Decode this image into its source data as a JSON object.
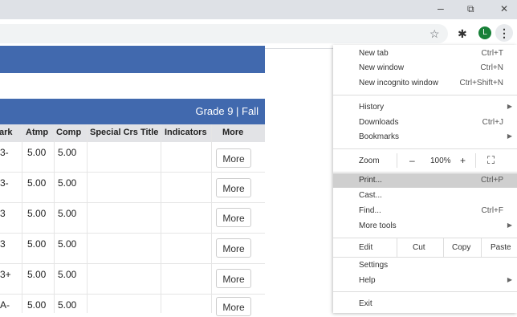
{
  "window": {
    "minimize_glyph": "–",
    "restore_glyph": "⧉",
    "close_glyph": "✕"
  },
  "toolbar": {
    "star_glyph": "☆",
    "extensions_glyph": "✱",
    "avatar_letter": "L",
    "menu_glyph": "⋮"
  },
  "table": {
    "grade_label": "Grade 9 | Fall",
    "columns": [
      "ark",
      "Atmp",
      "Comp",
      "Special Crs Title",
      "Indicators",
      "More"
    ],
    "rows": [
      {
        "mark": "3-",
        "atmp": "5.00",
        "comp": "5.00",
        "more": "More"
      },
      {
        "mark": "3-",
        "atmp": "5.00",
        "comp": "5.00",
        "more": "More"
      },
      {
        "mark": "3",
        "atmp": "5.00",
        "comp": "5.00",
        "more": "More"
      },
      {
        "mark": "3",
        "atmp": "5.00",
        "comp": "5.00",
        "more": "More"
      },
      {
        "mark": "3+",
        "atmp": "5.00",
        "comp": "5.00",
        "more": "More"
      },
      {
        "mark": "A-",
        "atmp": "5.00",
        "comp": "5.00",
        "more": "More"
      }
    ]
  },
  "menu": {
    "new_tab": "New tab",
    "new_tab_sc": "Ctrl+T",
    "new_window": "New window",
    "new_window_sc": "Ctrl+N",
    "incognito": "New incognito window",
    "incognito_sc": "Ctrl+Shift+N",
    "history": "History",
    "downloads": "Downloads",
    "downloads_sc": "Ctrl+J",
    "bookmarks": "Bookmarks",
    "zoom": "Zoom",
    "zoom_minus": "–",
    "zoom_value": "100%",
    "zoom_plus": "+",
    "fullscreen_glyph": "⛶",
    "print": "Print...",
    "print_sc": "Ctrl+P",
    "cast": "Cast...",
    "find": "Find...",
    "find_sc": "Ctrl+F",
    "more_tools": "More tools",
    "edit": "Edit",
    "cut": "Cut",
    "copy": "Copy",
    "paste": "Paste",
    "settings": "Settings",
    "help": "Help",
    "exit": "Exit",
    "arrow_glyph": "▶"
  }
}
